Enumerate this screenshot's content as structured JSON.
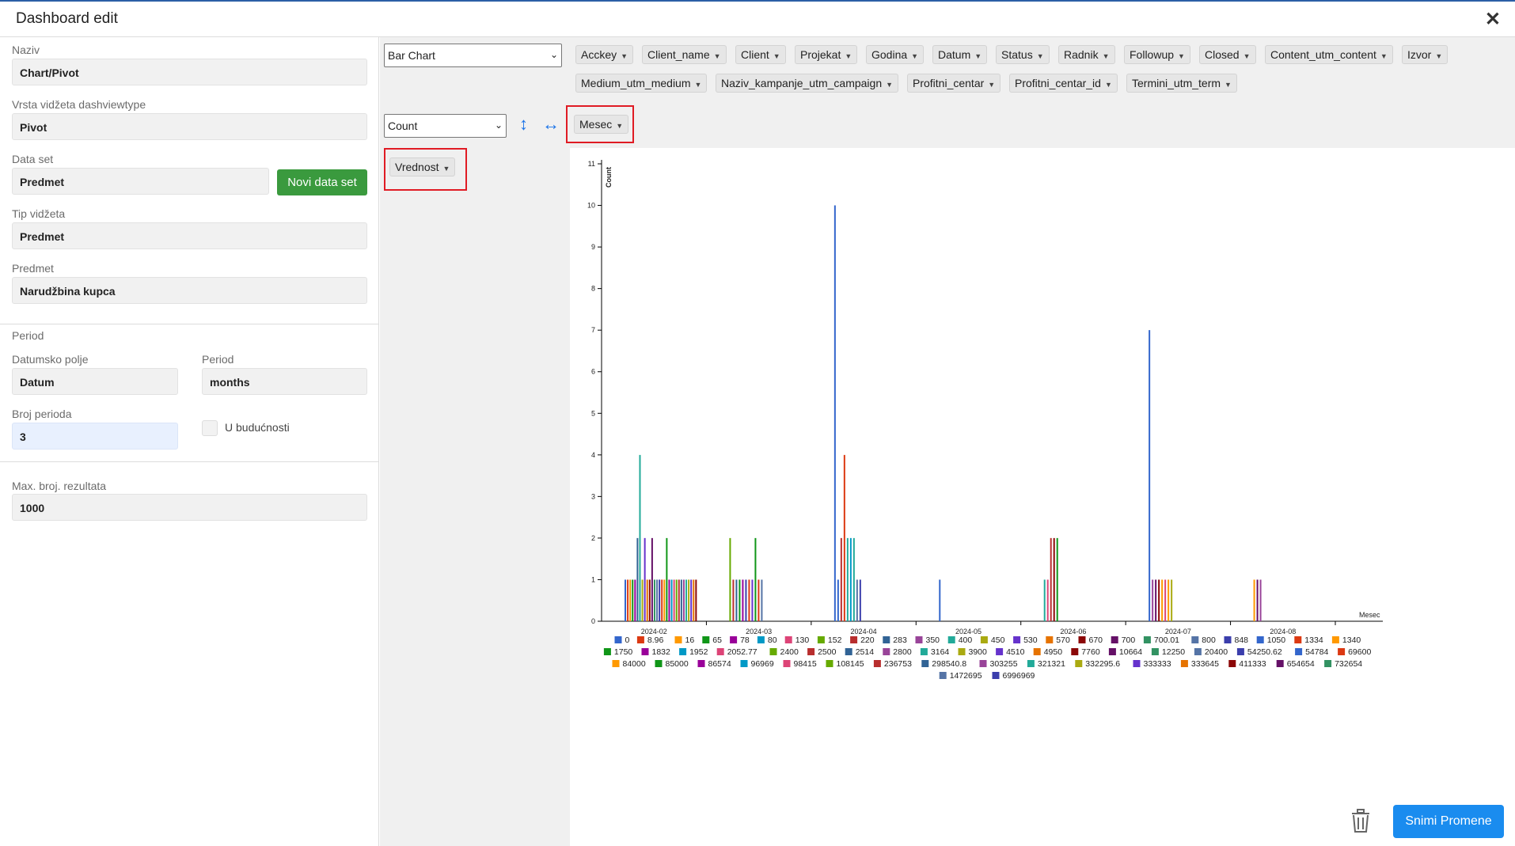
{
  "header": {
    "title": "Dashboard edit"
  },
  "form": {
    "naziv_label": "Naziv",
    "naziv_value": "Chart/Pivot",
    "vrsta_label": "Vrsta vidžeta dashviewtype",
    "vrsta_value": "Pivot",
    "dataset_label": "Data set",
    "dataset_value": "Predmet",
    "novi_button": "Novi data set",
    "tip_label": "Tip vidžeta",
    "tip_value": "Predmet",
    "predmet_label": "Predmet",
    "predmet_value": "Narudžbina kupca",
    "period_section": "Period",
    "datumsko_label": "Datumsko polje",
    "datumsko_value": "Datum",
    "period_label": "Period",
    "period_value": "months",
    "broj_label": "Broj perioda",
    "broj_value": "3",
    "buducnosti_label": "U budućnosti",
    "max_label": "Max. broj. rezultata",
    "max_value": "1000"
  },
  "pivot": {
    "renderer": "Bar Chart",
    "aggregator": "Count",
    "fields_row1": [
      "Acckey",
      "Client_name",
      "Client",
      "Projekat",
      "Godina",
      "Datum",
      "Status",
      "Radnik",
      "Followup",
      "Closed",
      "Content_utm_content",
      "Izvor"
    ],
    "fields_row2": [
      "Medium_utm_medium",
      "Naziv_kampanje_utm_campaign",
      "Profitni_centar",
      "Profitni_centar_id",
      "Termini_utm_term"
    ],
    "col_field": "Mesec",
    "row_field": "Vrednost"
  },
  "footer": {
    "save_label": "Snimi Promene"
  },
  "icons": {
    "close": "close-icon",
    "trash": "trash-icon",
    "vertical": "vertical-arrows-icon",
    "horizontal": "horizontal-arrows-icon"
  },
  "chart_data": {
    "type": "bar",
    "ylabel": "Count",
    "xlabel": "Mesec",
    "ylim": [
      0,
      11
    ],
    "yticks": [
      0,
      1,
      2,
      3,
      4,
      5,
      6,
      7,
      8,
      9,
      10,
      11
    ],
    "categories": [
      "2024-02",
      "2024-03",
      "2024-04",
      "2024-05",
      "2024-06",
      "2024-07",
      "2024-08"
    ],
    "legend": [
      "0",
      "8.96",
      "16",
      "65",
      "78",
      "80",
      "130",
      "152",
      "220",
      "283",
      "350",
      "400",
      "450",
      "530",
      "570",
      "670",
      "700",
      "700.01",
      "800",
      "848",
      "1050",
      "1334",
      "1340",
      "1750",
      "1832",
      "1952",
      "2052.77",
      "2400",
      "2500",
      "2514",
      "2800",
      "3164",
      "3900",
      "4510",
      "4950",
      "7760",
      "10664",
      "12250",
      "20400",
      "54250.62",
      "54784",
      "69600",
      "84000",
      "85000",
      "86574",
      "96969",
      "98415",
      "108145",
      "236753",
      "298540.8",
      "303255",
      "321321",
      "332295.6",
      "333333",
      "333645",
      "411333",
      "654654",
      "732654",
      "1472695",
      "6996969"
    ],
    "colors": [
      "#3366cc",
      "#dc3912",
      "#ff9900",
      "#109618",
      "#990099",
      "#0099c6",
      "#dd4477",
      "#66aa00",
      "#b82e2e",
      "#316395",
      "#994499",
      "#22aa99",
      "#aaaa11",
      "#6633cc",
      "#e67300",
      "#8b0707",
      "#651067",
      "#329262",
      "#5574a6",
      "#3b3eac"
    ],
    "bars": [
      {
        "cat": 0,
        "values": [
          {
            "s": 0,
            "v": 1
          },
          {
            "s": 1,
            "v": 1
          },
          {
            "s": 2,
            "v": 1
          },
          {
            "s": 3,
            "v": 1
          },
          {
            "s": 4,
            "v": 1
          },
          {
            "s": 9,
            "v": 2
          },
          {
            "s": 11,
            "v": 4
          },
          {
            "s": 12,
            "v": 1
          },
          {
            "s": 13,
            "v": 2
          },
          {
            "s": 14,
            "v": 1
          },
          {
            "s": 15,
            "v": 1
          },
          {
            "s": 16,
            "v": 2
          },
          {
            "s": 17,
            "v": 1
          },
          {
            "s": 18,
            "v": 1
          },
          {
            "s": 19,
            "v": 1
          },
          {
            "s": 21,
            "v": 1
          },
          {
            "s": 22,
            "v": 1
          },
          {
            "s": 23,
            "v": 2
          },
          {
            "s": 24,
            "v": 1
          },
          {
            "s": 25,
            "v": 1
          },
          {
            "s": 26,
            "v": 1
          },
          {
            "s": 27,
            "v": 1
          },
          {
            "s": 28,
            "v": 1
          },
          {
            "s": 29,
            "v": 1
          },
          {
            "s": 30,
            "v": 1
          },
          {
            "s": 31,
            "v": 1
          },
          {
            "s": 32,
            "v": 1
          },
          {
            "s": 33,
            "v": 1
          },
          {
            "s": 34,
            "v": 1
          },
          {
            "s": 35,
            "v": 1
          }
        ]
      },
      {
        "cat": 1,
        "values": [
          {
            "s": 7,
            "v": 2
          },
          {
            "s": 8,
            "v": 1
          },
          {
            "s": 9,
            "v": 1
          },
          {
            "s": 3,
            "v": 1
          },
          {
            "s": 4,
            "v": 1
          },
          {
            "s": 19,
            "v": 1
          },
          {
            "s": 1,
            "v": 1
          },
          {
            "s": 13,
            "v": 1
          },
          {
            "s": 3,
            "v": 2
          },
          {
            "s": 1,
            "v": 1
          },
          {
            "s": 18,
            "v": 1
          }
        ]
      },
      {
        "cat": 2,
        "values": [
          {
            "s": 0,
            "v": 10
          },
          {
            "s": 0,
            "v": 1
          },
          {
            "s": 8,
            "v": 2
          },
          {
            "s": 1,
            "v": 4
          },
          {
            "s": 11,
            "v": 2
          },
          {
            "s": 5,
            "v": 2
          },
          {
            "s": 11,
            "v": 2
          },
          {
            "s": 18,
            "v": 1
          },
          {
            "s": 19,
            "v": 1
          }
        ]
      },
      {
        "cat": 3,
        "values": [
          {
            "s": 0,
            "v": 1
          }
        ]
      },
      {
        "cat": 4,
        "values": [
          {
            "s": 11,
            "v": 1
          },
          {
            "s": 6,
            "v": 1
          },
          {
            "s": 8,
            "v": 2
          },
          {
            "s": 15,
            "v": 2
          },
          {
            "s": 3,
            "v": 2
          }
        ]
      },
      {
        "cat": 5,
        "values": [
          {
            "s": 0,
            "v": 7
          },
          {
            "s": 10,
            "v": 1
          },
          {
            "s": 16,
            "v": 1
          },
          {
            "s": 15,
            "v": 1
          },
          {
            "s": 2,
            "v": 1
          },
          {
            "s": 6,
            "v": 1
          },
          {
            "s": 2,
            "v": 1
          },
          {
            "s": 12,
            "v": 1
          }
        ]
      },
      {
        "cat": 6,
        "values": [
          {
            "s": 2,
            "v": 1
          },
          {
            "s": 16,
            "v": 1
          },
          {
            "s": 10,
            "v": 1
          }
        ]
      }
    ]
  }
}
